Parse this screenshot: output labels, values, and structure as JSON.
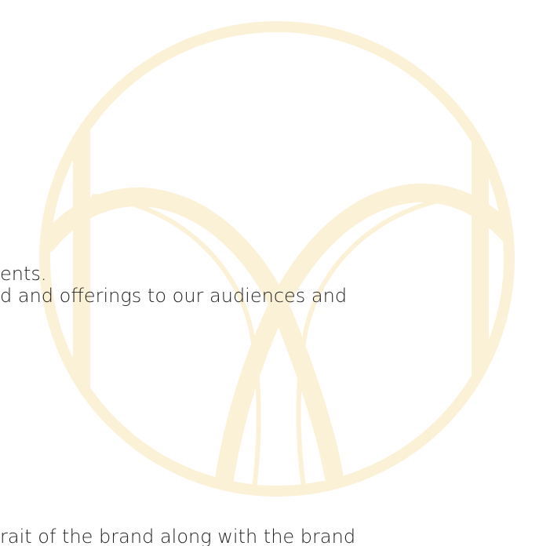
{
  "watermark": {
    "icon": "monogram-m-circle-icon",
    "color": "#fbf1d6"
  },
  "text": {
    "line_1": "ents.",
    "line_2": "d and offerings to our audiences and",
    "line_3": "rait of the brand along with the brand"
  }
}
